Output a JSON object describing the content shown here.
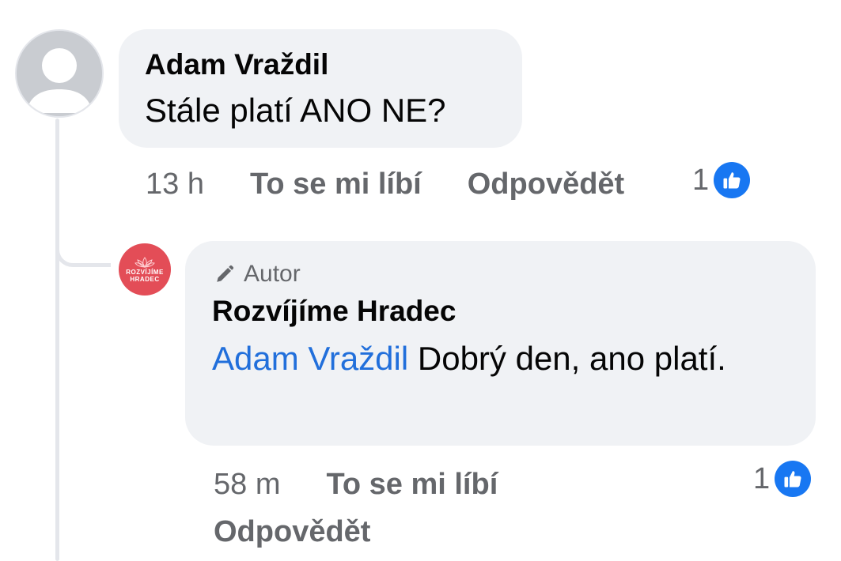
{
  "comment": {
    "author": "Adam Vraždil",
    "text": "Stále platí ANO NE?",
    "time": "13 h",
    "like_label": "To se mi líbí",
    "reply_label": "Odpovědět",
    "reaction_count": "1",
    "reaction_icon": "thumbs-up-icon"
  },
  "reply": {
    "badge_label": "Autor",
    "badge_icon": "pencil-icon",
    "author": "Rozvíjíme Hradec",
    "avatar_text": "ROZVÍJÍME HRADEC",
    "mention": "Adam Vraždil",
    "text": " Dobrý den, ano platí.",
    "time": "58 m",
    "like_label": "To se mi líbí",
    "reply_label": "Odpovědět",
    "reaction_count": "1",
    "reaction_icon": "thumbs-up-icon"
  },
  "colors": {
    "bubble": "#f0f2f5",
    "meta_text": "#65676b",
    "mention": "#216fdb",
    "like_badge": "#1877f2",
    "page_avatar": "#e34d57"
  }
}
